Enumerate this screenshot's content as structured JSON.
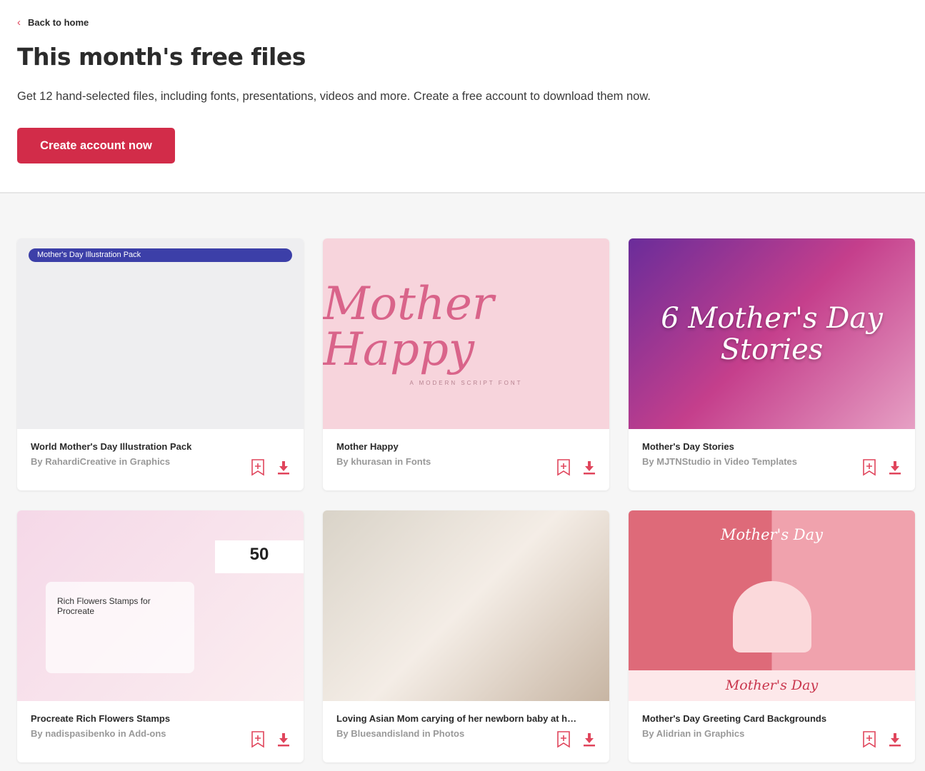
{
  "nav": {
    "back_label": "Back to home"
  },
  "header": {
    "title": "This month's free files",
    "subtitle": "Get 12 hand-selected files, including fonts, presentations, videos and more. Create a free account to download them now.",
    "cta_label": "Create account now"
  },
  "colors": {
    "accent": "#d22c49",
    "icon": "#e0455c"
  },
  "icons": {
    "back": "chevron-left-icon",
    "bookmark": "bookmark-plus-icon",
    "download": "download-icon"
  },
  "by_label": "By",
  "in_label": "in",
  "cards": [
    {
      "title": "World Mother's Day Illustration Pack",
      "author": "RahardiCreative",
      "category": "Graphics",
      "thumb_text": "Mother's Day Illustration Pack"
    },
    {
      "title": "Mother Happy",
      "author": "khurasan",
      "category": "Fonts",
      "thumb_text": "Mother Happy",
      "thumb_sub": "A MODERN SCRIPT FONT"
    },
    {
      "title": "Mother's Day Stories",
      "author": "MJTNStudio",
      "category": "Video Templates",
      "thumb_text": "6 Mother's Day Stories"
    },
    {
      "title": "Procreate Rich Flowers Stamps",
      "author": "nadispasibenko",
      "category": "Add-ons",
      "thumb_text": "Rich Flowers Stamps for Procreate",
      "thumb_sub": "50"
    },
    {
      "title": "Loving Asian Mom carying of her newborn baby at ho...",
      "author": "Bluesandisland",
      "category": "Photos",
      "thumb_text": ""
    },
    {
      "title": "Mother's Day Greeting Card Backgrounds",
      "author": "Alidrian",
      "category": "Graphics",
      "thumb_text": "Mother's Day",
      "thumb_sub": "Mother's Day"
    }
  ]
}
